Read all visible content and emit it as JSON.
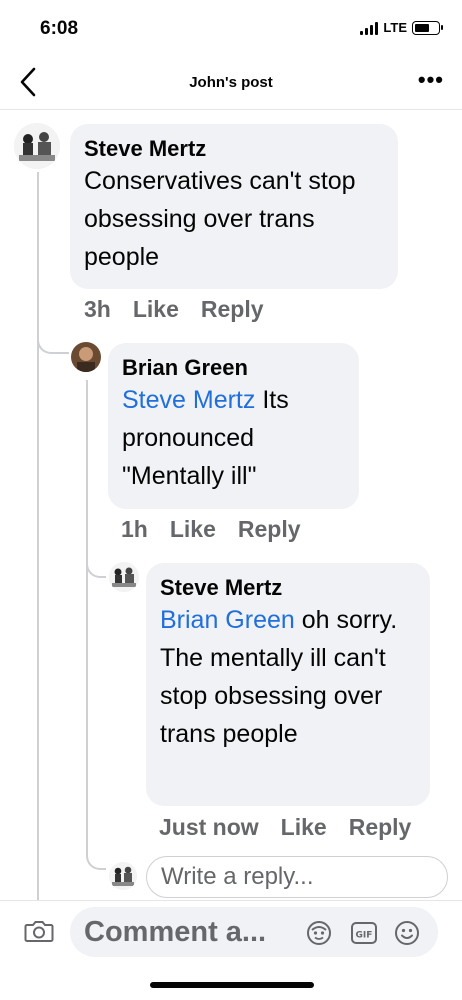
{
  "status_bar": {
    "time": "6:08",
    "network": "LTE"
  },
  "header": {
    "title": "John's post",
    "more_label": "•••"
  },
  "comments": [
    {
      "author": "Steve Mertz",
      "mention": "",
      "text": "Conservatives can't stop obsessing over trans people",
      "time": "3h",
      "like_label": "Like",
      "reply_label": "Reply"
    },
    {
      "author": "Brian Green",
      "mention": "Steve Mertz",
      "text": "Its pronounced \"Mentally ill\"",
      "time": "1h",
      "like_label": "Like",
      "reply_label": "Reply"
    },
    {
      "author": "Steve Mertz",
      "mention": "Brian Green",
      "text": "oh sorry. The mentally ill can't stop obsessing over trans people",
      "time": "Just now",
      "like_label": "Like",
      "reply_label": "Reply"
    }
  ],
  "reply_input": {
    "placeholder": "Write a reply..."
  },
  "comment_input": {
    "placeholder": "Comment a..."
  },
  "icons": {
    "back": "chevron-left-icon",
    "more": "more-icon",
    "camera": "camera-icon",
    "avatar_sticker": "avatar-sticker-icon",
    "gif": "gif-icon",
    "emoji": "emoji-icon"
  },
  "colors": {
    "mention": "#216fdb",
    "bubble": "#f0f2f5",
    "meta": "#65676b"
  }
}
